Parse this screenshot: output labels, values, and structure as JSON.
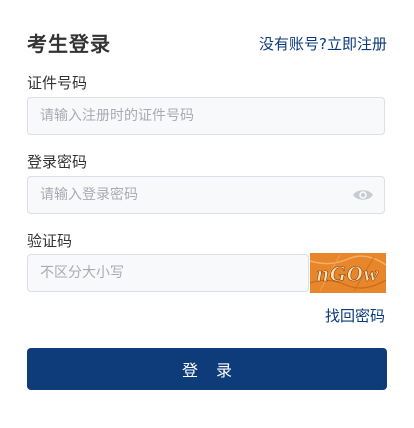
{
  "header": {
    "title": "考生登录",
    "register_link": "没有账号?立即注册"
  },
  "form": {
    "id_label": "证件号码",
    "id_placeholder": "请输入注册时的证件号码",
    "password_label": "登录密码",
    "password_placeholder": "请输入登录密码",
    "captcha_label": "验证码",
    "captcha_placeholder": "不区分大小写",
    "captcha_text": "nGOw",
    "forgot_link": "找回密码",
    "submit_label": "登录"
  },
  "colors": {
    "accent": "#0e3c7a",
    "link": "#0a3a7a",
    "captcha_bg": "#e8862c"
  },
  "icons": {
    "password_toggle": "eye-icon"
  }
}
